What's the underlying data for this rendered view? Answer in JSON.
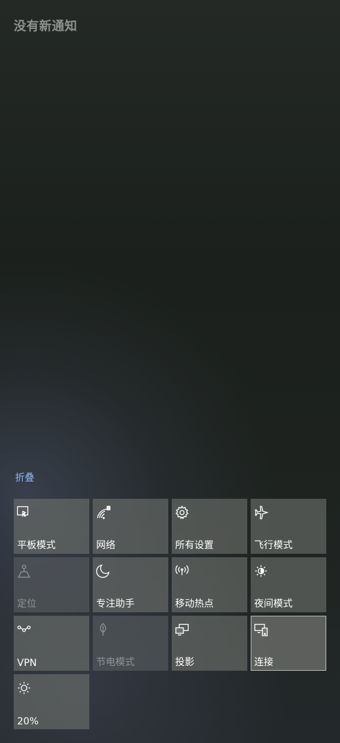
{
  "notifications": {
    "empty_title": "没有新通知"
  },
  "action_center": {
    "collapse_label": "折叠",
    "tiles": [
      {
        "label": "平板模式",
        "icon": "tablet-mode-icon"
      },
      {
        "label": "网络",
        "icon": "network-icon"
      },
      {
        "label": "所有设置",
        "icon": "settings-gear-icon"
      },
      {
        "label": "飞行模式",
        "icon": "airplane-icon"
      },
      {
        "label": "定位",
        "icon": "location-icon",
        "state": "disabled"
      },
      {
        "label": "专注助手",
        "icon": "moon-icon"
      },
      {
        "label": "移动热点",
        "icon": "hotspot-icon"
      },
      {
        "label": "夜间模式",
        "icon": "night-light-icon"
      },
      {
        "label": "VPN",
        "icon": "vpn-icon"
      },
      {
        "label": "节电模式",
        "icon": "battery-saver-leaf-icon",
        "state": "disabled"
      },
      {
        "label": "投影",
        "icon": "project-icon"
      },
      {
        "label": "连接",
        "icon": "connect-icon",
        "state": "selected"
      },
      {
        "label": "20%",
        "icon": "brightness-sun-icon"
      }
    ]
  },
  "colors": {
    "accent_link": "#8cb6ea",
    "tile_background": "#6e716c",
    "background": "#1c211d"
  }
}
